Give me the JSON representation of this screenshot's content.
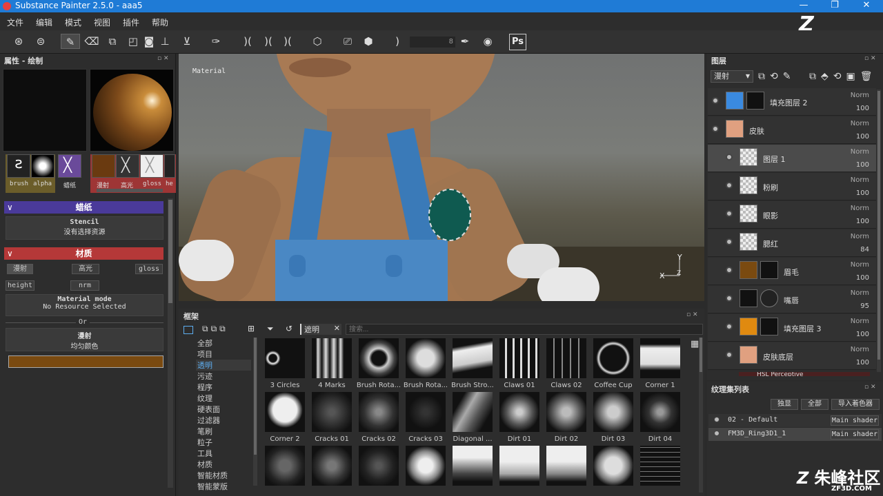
{
  "app": {
    "title": "Substance Painter 2.5.0 - aaa5",
    "win_min": "—",
    "win_max": "❐",
    "win_close": "✕"
  },
  "menu": [
    "文件",
    "编辑",
    "模式",
    "视图",
    "插件",
    "帮助"
  ],
  "toolbar": {
    "size_value": "8",
    "ps": "Ps",
    "watermark_logo": "Z"
  },
  "props": {
    "title": "属性 - 绘制",
    "thumbs": [
      {
        "label": "brush"
      },
      {
        "label": "alpha"
      },
      {
        "label": "蜡纸"
      },
      {
        "label": "漫射"
      },
      {
        "label": "高光"
      },
      {
        "label": "gloss"
      },
      {
        "label": "he"
      }
    ],
    "stencil_title": "蜡纸",
    "stencil_name": "Stencil",
    "stencil_value": "没有选择资源",
    "material_title": "材质",
    "channels": [
      "漫射",
      "高光",
      "gloss",
      "height",
      "nrm"
    ],
    "material_mode": "Material mode",
    "no_resource": "No Resource Selected",
    "or": "Or",
    "diffuse_label": "漫射",
    "uniform_color": "均匀颜色",
    "color": "#7a4a10"
  },
  "viewport": {
    "label": "Material",
    "axis_y": "Y",
    "axis_x": "X",
    "axis_z": "Z"
  },
  "shelf": {
    "title": "框架",
    "filter": "遮明",
    "search_placeholder": "搜索...",
    "categories": [
      "全部",
      "项目",
      "透明",
      "污迹",
      "程序",
      "纹理",
      "硬表面",
      "过滤器",
      "笔刷",
      "粒子",
      "工具",
      "材质",
      "智能材质",
      "智能蒙版"
    ],
    "selected_category": 2,
    "row1": [
      "3 Circles",
      "4 Marks",
      "Brush Rota...",
      "Brush Rota...",
      "Brush Stro...",
      "Claws 01",
      "Claws 02",
      "Coffee Cup",
      "Corner 1"
    ],
    "row2": [
      "Corner 2",
      "Cracks 01",
      "Cracks 02",
      "Cracks 03",
      "Diagonal ...",
      "Dirt 01",
      "Dirt 02",
      "Dirt 03",
      "Dirt 04"
    ]
  },
  "layers": {
    "title": "图层",
    "blend": "漫射",
    "items": [
      {
        "name": "填充图层 2",
        "mode": "Norm",
        "op": "100"
      },
      {
        "name": "皮肤",
        "mode": "Norm",
        "op": "100"
      },
      {
        "name": "图层 1",
        "mode": "Norm",
        "op": "100"
      },
      {
        "name": "粉刷",
        "mode": "Norm",
        "op": "100"
      },
      {
        "name": "眼影",
        "mode": "Norm",
        "op": "100"
      },
      {
        "name": "腮红",
        "mode": "Norm",
        "op": "84"
      },
      {
        "name": "眉毛",
        "mode": "Norm",
        "op": "100"
      },
      {
        "name": "嘴唇",
        "mode": "Norm",
        "op": "95"
      },
      {
        "name": "填充图层 3",
        "mode": "Norm",
        "op": "100"
      },
      {
        "name": "皮肤底层",
        "mode": "Norm",
        "op": "100"
      }
    ],
    "effect": "HSL Perceptive"
  },
  "texlist": {
    "title": "纹理集列表",
    "btn_solo": "独显",
    "btn_all": "全部",
    "btn_import": "导入着色器",
    "rows": [
      {
        "name": "02 - Default",
        "shader": "Main shader"
      },
      {
        "name": "FM3D_Ring3D1_1",
        "shader": "Main shader"
      }
    ]
  },
  "watermark": {
    "text": "朱峰社区",
    "url": "ZF3D.COM"
  }
}
